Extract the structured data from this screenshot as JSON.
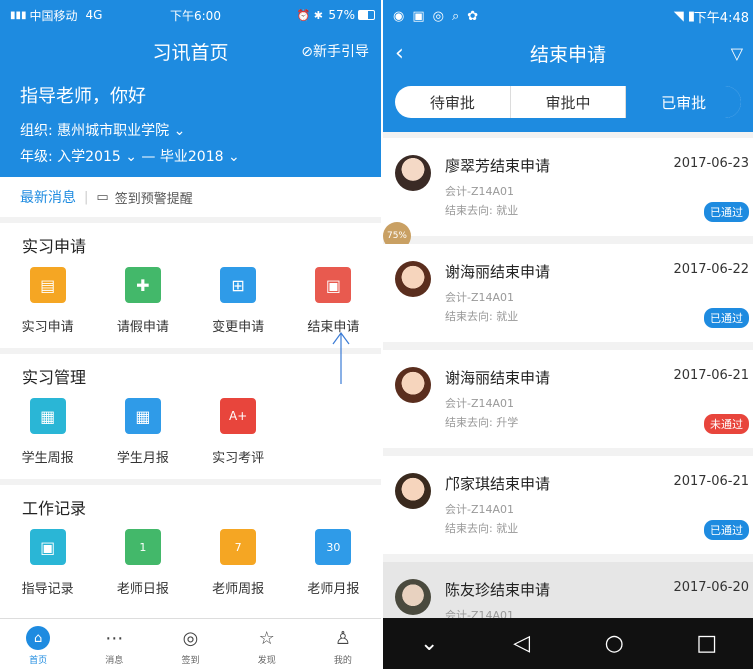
{
  "left": {
    "status": {
      "carrier": "中国移动",
      "network": "4G",
      "time": "下午6:00",
      "battery": "57%"
    },
    "header": {
      "title": "习讯首页",
      "guide": "新手引导"
    },
    "welcome": {
      "greeting": "指导老师，你好",
      "org": "组织: 惠州城市职业学院 ⌄",
      "grade": "年级: 入学2015 ⌄ — 毕业2018 ⌄"
    },
    "news": {
      "title": "最新消息",
      "item": "签到预警提醒"
    },
    "sections": [
      {
        "title": "实习申请",
        "items": [
          {
            "label": "实习申请",
            "icon": "document-icon",
            "color": "#f5a623"
          },
          {
            "label": "请假申请",
            "icon": "leave-icon",
            "color": "#43b86a"
          },
          {
            "label": "变更申请",
            "icon": "change-icon",
            "color": "#2f9be8"
          },
          {
            "label": "结束申请",
            "icon": "end-icon",
            "color": "#e85a4f"
          }
        ]
      },
      {
        "title": "实习管理",
        "items": [
          {
            "label": "学生周报",
            "icon": "weekly-report-icon",
            "color": "#2ab6d6"
          },
          {
            "label": "学生月报",
            "icon": "monthly-report-icon",
            "color": "#2f9be8"
          },
          {
            "label": "实习考评",
            "icon": "grade-icon",
            "color": "#e8453c"
          }
        ]
      },
      {
        "title": "工作记录",
        "items": [
          {
            "label": "指导记录",
            "icon": "guide-record-icon",
            "color": "#2ab6d6"
          },
          {
            "label": "老师日报",
            "icon": "daily-report-icon",
            "color": "#43b86a"
          },
          {
            "label": "老师周报",
            "icon": "weekly-icon",
            "color": "#f5a623"
          },
          {
            "label": "老师月报",
            "icon": "monthly-icon",
            "color": "#2f9be8"
          }
        ]
      }
    ],
    "tabbar": [
      {
        "label": "首页",
        "icon": "home-icon"
      },
      {
        "label": "消息",
        "icon": "message-icon"
      },
      {
        "label": "签到",
        "icon": "location-icon"
      },
      {
        "label": "发现",
        "icon": "star-icon"
      },
      {
        "label": "我的",
        "icon": "user-icon"
      }
    ]
  },
  "right": {
    "status": {
      "time": "下午4:48"
    },
    "header": {
      "title": "结束申请"
    },
    "tabs": [
      "待审批",
      "审批中",
      "已审批"
    ],
    "overlay_badge": "75%",
    "items": [
      {
        "title": "廖翠芳结束申请",
        "date": "2017-06-23",
        "major": "会计-Z14A01",
        "dest": "结束去向: 就业",
        "status": "已通过",
        "status_color": "#1e8be0"
      },
      {
        "title": "谢海丽结束申请",
        "date": "2017-06-22",
        "major": "会计-Z14A01",
        "dest": "结束去向: 就业",
        "status": "已通过",
        "status_color": "#1e8be0"
      },
      {
        "title": "谢海丽结束申请",
        "date": "2017-06-21",
        "major": "会计-Z14A01",
        "dest": "结束去向: 升学",
        "status": "未通过",
        "status_color": "#e8453c"
      },
      {
        "title": "邝家琪结束申请",
        "date": "2017-06-21",
        "major": "会计-Z14A01",
        "dest": "结束去向: 就业",
        "status": "已通过",
        "status_color": "#1e8be0"
      },
      {
        "title": "陈友珍结束申请",
        "date": "2017-06-20",
        "major": "会计-Z14A01"
      }
    ]
  }
}
